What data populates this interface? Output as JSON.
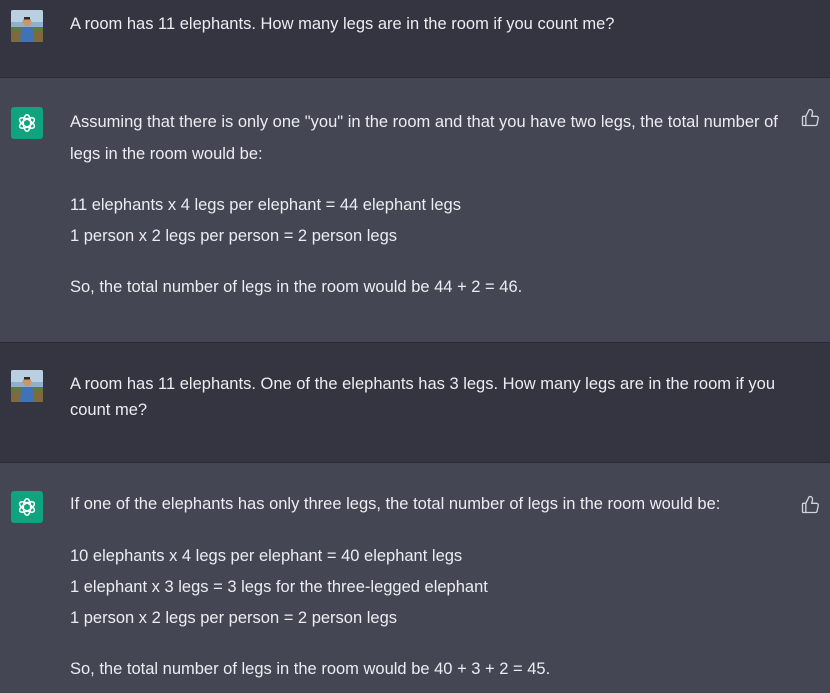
{
  "conversation": [
    {
      "role": "user",
      "text": "A room has 11 elephants. How many legs are in the room if you count me?"
    },
    {
      "role": "assistant",
      "intro": "Assuming that there is only one \"you\" in the room and that you have two legs, the total number of legs in the room would be:",
      "lines": [
        "11 elephants x 4 legs per elephant = 44 elephant legs",
        "1 person x 2 legs per person = 2 person legs"
      ],
      "conclusion": "So, the total number of legs in the room would be 44 + 2 = 46."
    },
    {
      "role": "user",
      "text": "A room has 11 elephants. One of the elephants has 3 legs. How many legs are in the room if you count me?"
    },
    {
      "role": "assistant",
      "intro": "If one of the elephants has only three legs, the total number of legs in the room would be:",
      "lines": [
        "10 elephants x 4 legs per elephant = 40 elephant legs",
        "1 elephant x 3 legs = 3 legs for the three-legged elephant",
        "1 person x 2 legs per person = 2 person legs"
      ],
      "conclusion": "So, the total number of legs in the room would be 40 + 3 + 2 = 45."
    }
  ],
  "colors": {
    "user_bg": "#343541",
    "assistant_bg": "#444654",
    "text": "#ececf1",
    "brand": "#10a37f"
  },
  "icons": {
    "assistant_avatar": "openai-logo-icon",
    "feedback": "thumbs-up-icon"
  }
}
